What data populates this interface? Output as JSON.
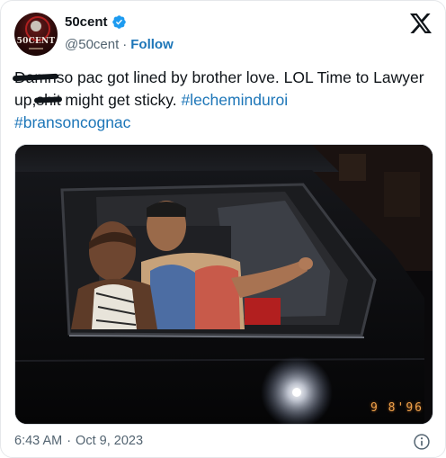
{
  "author": {
    "display_name": "50cent",
    "handle": "@50cent",
    "follow_label": "Follow",
    "separator": "·",
    "avatar_text": "50CENT",
    "verified_color": "#1d9bf0"
  },
  "tweet": {
    "redacted_1": "Damn",
    "text_1": "so pac got lined by brother love. LOL Time to Lawyer up,",
    "redacted_2": "shit",
    "text_2": " might get sticky. ",
    "hashtag_1": "#lecheminduroi",
    "hashtag_2": "#bransoncognac"
  },
  "media": {
    "date_stamp": "9  8'96"
  },
  "meta": {
    "time": "6:43 AM",
    "separator": "·",
    "date": "Oct 9, 2023"
  },
  "icons": {
    "verified": "verified-badge-icon",
    "platform": "x-logo-icon",
    "info": "info-icon"
  },
  "colors": {
    "link": "#1d76b8",
    "text": "#0f1419",
    "muted": "#536471"
  }
}
